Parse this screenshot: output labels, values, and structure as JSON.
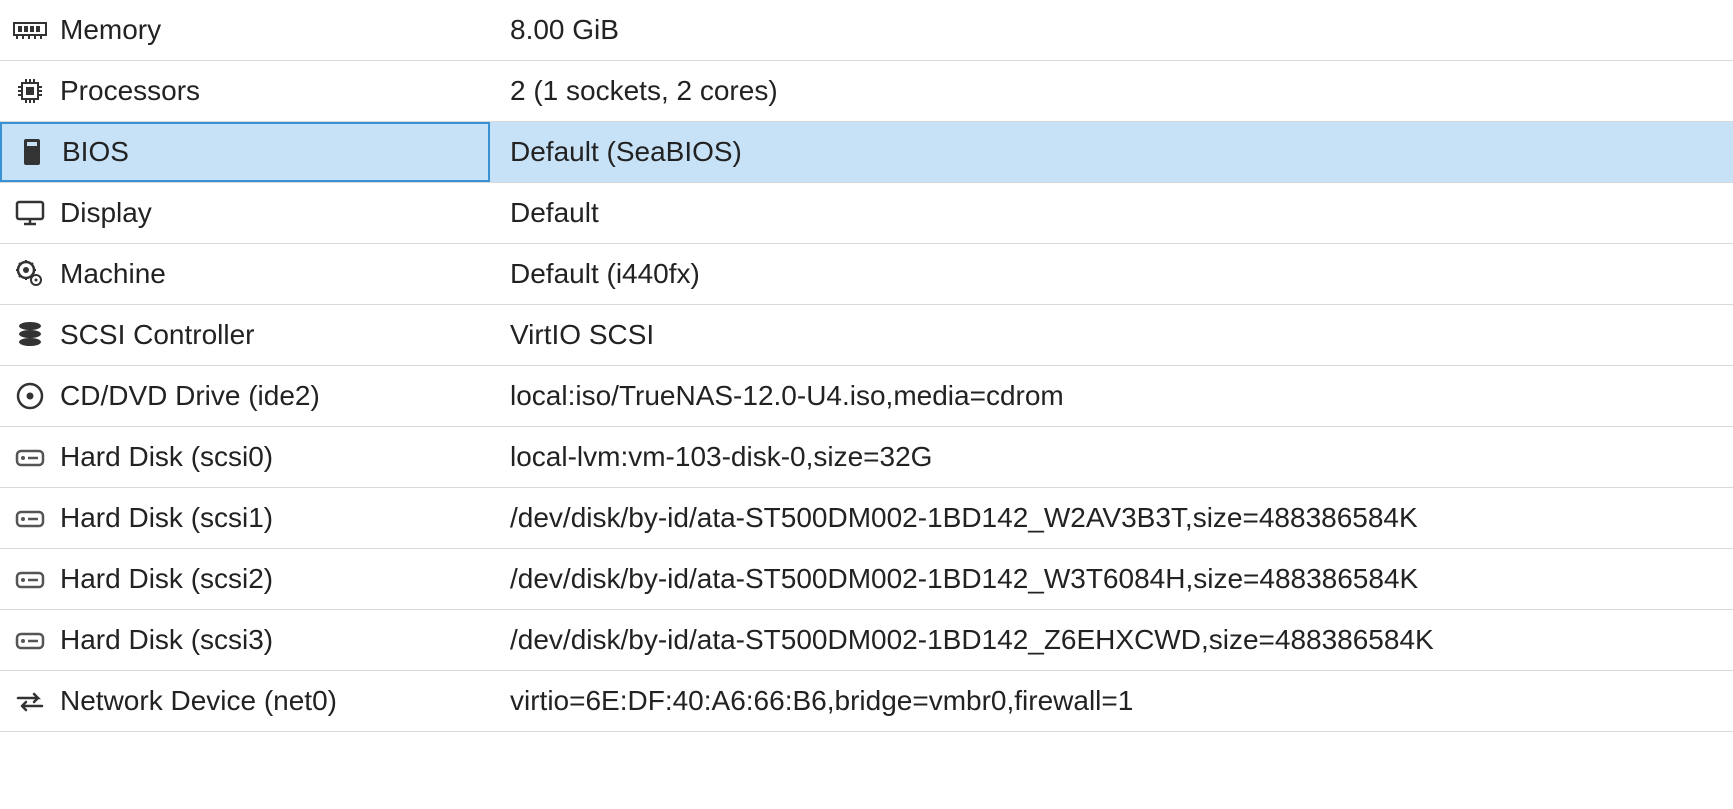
{
  "hardware": [
    {
      "icon": "memory-icon",
      "label": "Memory",
      "value": "8.00 GiB",
      "selected": false
    },
    {
      "icon": "cpu-icon",
      "label": "Processors",
      "value": "2 (1 sockets, 2 cores)",
      "selected": false
    },
    {
      "icon": "bios-icon",
      "label": "BIOS",
      "value": "Default (SeaBIOS)",
      "selected": true
    },
    {
      "icon": "display-icon",
      "label": "Display",
      "value": "Default",
      "selected": false
    },
    {
      "icon": "machine-icon",
      "label": "Machine",
      "value": "Default (i440fx)",
      "selected": false
    },
    {
      "icon": "storage-icon",
      "label": "SCSI Controller",
      "value": "VirtIO SCSI",
      "selected": false
    },
    {
      "icon": "disc-icon",
      "label": "CD/DVD Drive (ide2)",
      "value": "local:iso/TrueNAS-12.0-U4.iso,media=cdrom",
      "selected": false
    },
    {
      "icon": "hdd-icon",
      "label": "Hard Disk (scsi0)",
      "value": "local-lvm:vm-103-disk-0,size=32G",
      "selected": false
    },
    {
      "icon": "hdd-icon",
      "label": "Hard Disk (scsi1)",
      "value": "/dev/disk/by-id/ata-ST500DM002-1BD142_W2AV3B3T,size=488386584K",
      "selected": false
    },
    {
      "icon": "hdd-icon",
      "label": "Hard Disk (scsi2)",
      "value": "/dev/disk/by-id/ata-ST500DM002-1BD142_W3T6084H,size=488386584K",
      "selected": false
    },
    {
      "icon": "hdd-icon",
      "label": "Hard Disk (scsi3)",
      "value": "/dev/disk/by-id/ata-ST500DM002-1BD142_Z6EHXCWD,size=488386584K",
      "selected": false
    },
    {
      "icon": "network-icon",
      "label": "Network Device (net0)",
      "value": "virtio=6E:DF:40:A6:66:B6,bridge=vmbr0,firewall=1",
      "selected": false
    }
  ]
}
